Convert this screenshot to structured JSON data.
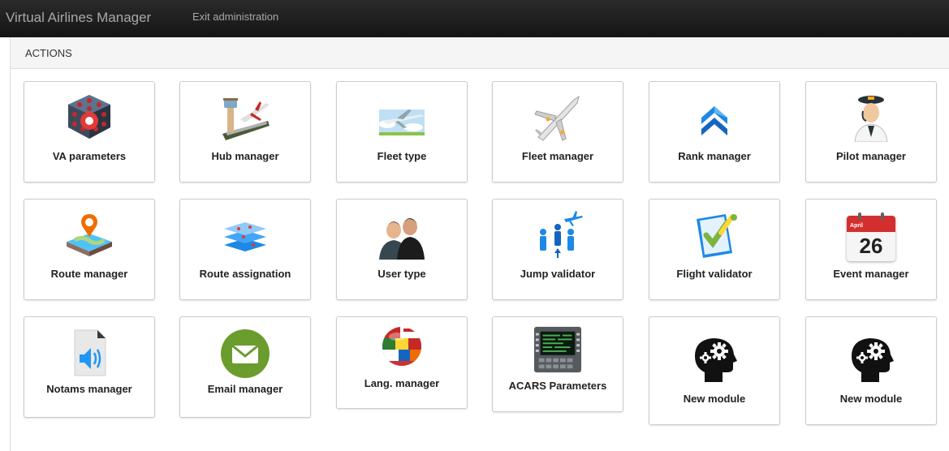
{
  "navbar": {
    "brand": "Virtual Airlines Manager",
    "exit_link": "Exit administration"
  },
  "panel": {
    "title": "ACTIONS"
  },
  "modules": [
    {
      "label": "VA parameters",
      "icon": "cube-icon"
    },
    {
      "label": "Hub manager",
      "icon": "airport-tower-icon"
    },
    {
      "label": "Fleet type",
      "icon": "airplane-sky-icon"
    },
    {
      "label": "Fleet manager",
      "icon": "airplane-icon"
    },
    {
      "label": "Rank manager",
      "icon": "chevron-rank-icon"
    },
    {
      "label": "Pilot manager",
      "icon": "pilot-icon"
    },
    {
      "label": "Route manager",
      "icon": "map-pin-icon"
    },
    {
      "label": "Route assignation",
      "icon": "layered-maps-icon"
    },
    {
      "label": "User type",
      "icon": "users-icon"
    },
    {
      "label": "Jump validator",
      "icon": "jump-people-icon"
    },
    {
      "label": "Flight validator",
      "icon": "checklist-icon"
    },
    {
      "label": "Event manager",
      "icon": "calendar-icon",
      "calendar_month": "April",
      "calendar_day": "26"
    },
    {
      "label": "Notams manager",
      "icon": "audio-file-icon"
    },
    {
      "label": "Email manager",
      "icon": "envelope-icon"
    },
    {
      "label": "Lang. manager",
      "icon": "flags-globe-icon"
    },
    {
      "label": "ACARS Parameters",
      "icon": "acars-screen-icon"
    },
    {
      "label": "New module",
      "icon": "head-gears-icon"
    },
    {
      "label": "New module",
      "icon": "head-gears-icon"
    }
  ]
}
